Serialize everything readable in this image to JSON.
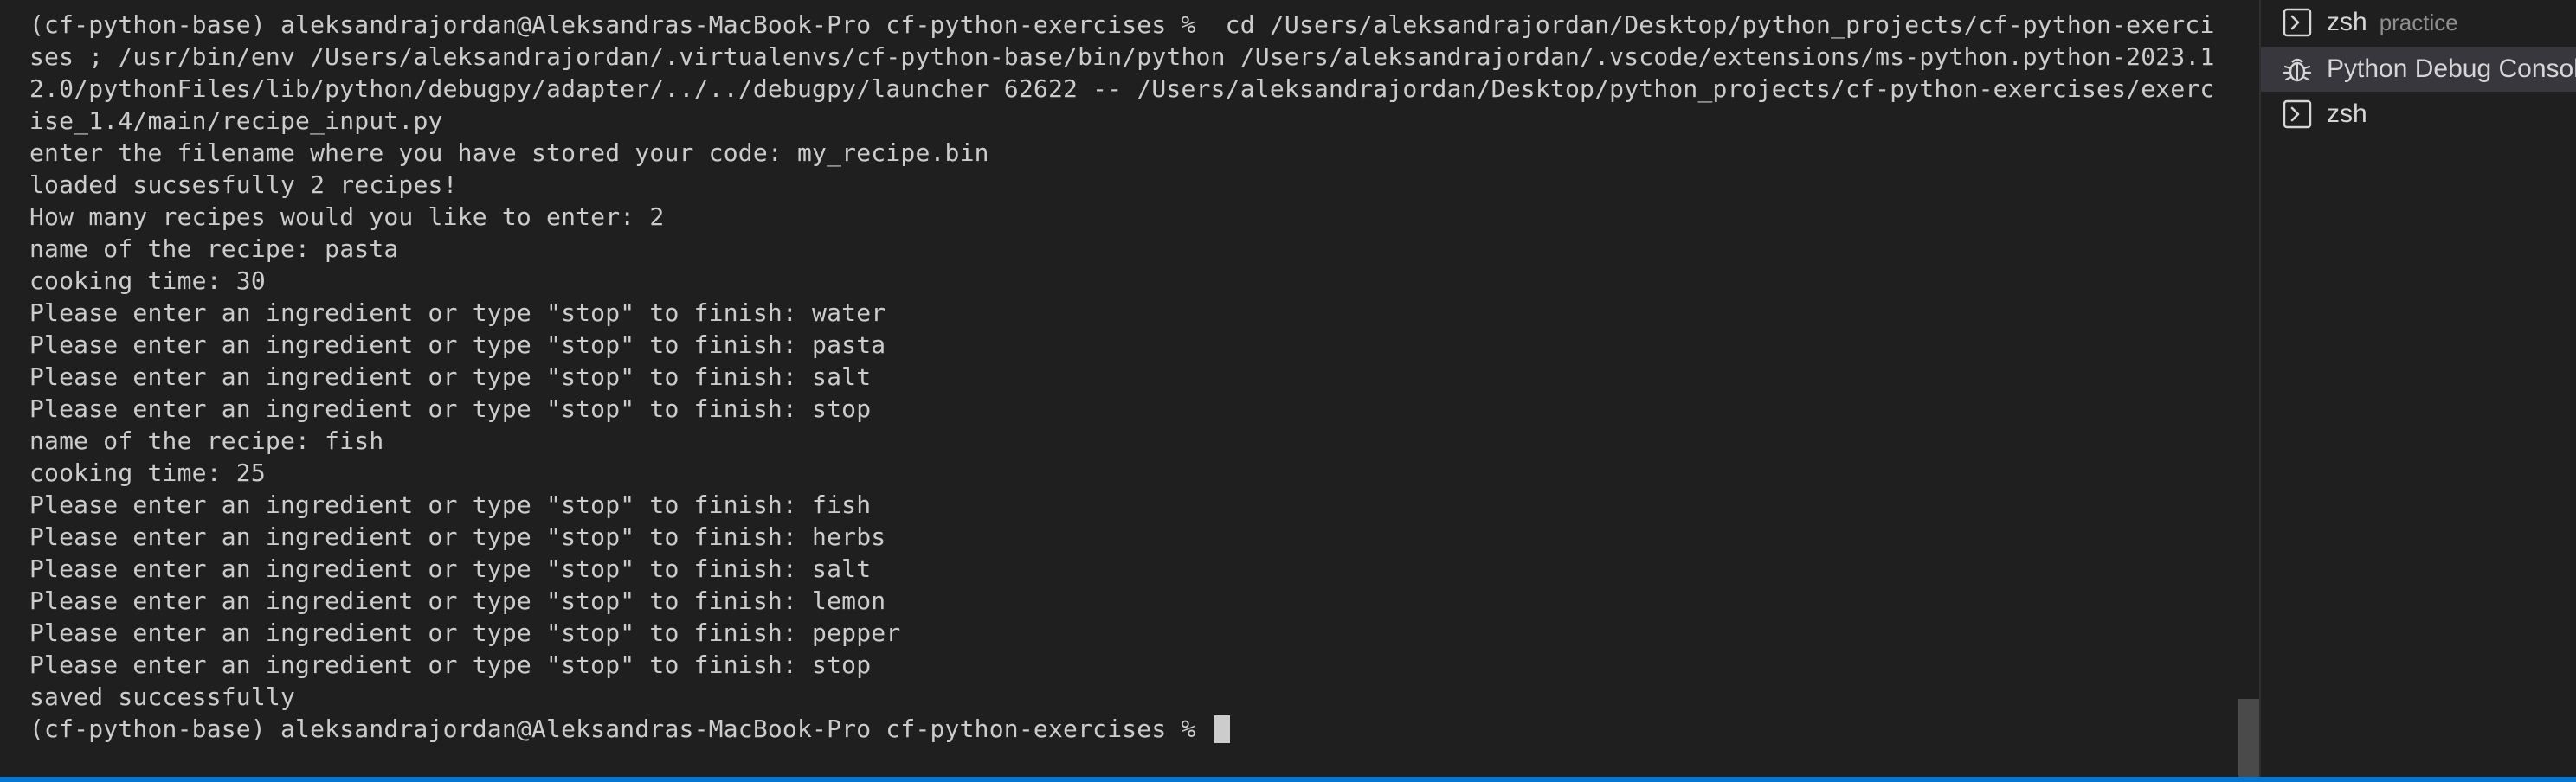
{
  "terminal": {
    "lines": [
      "(cf-python-base) aleksandrajordan@Aleksandras-MacBook-Pro cf-python-exercises %  cd /Users/aleksandrajordan/Desktop/python_projects/cf-python-exerci",
      "ses ; /usr/bin/env /Users/aleksandrajordan/.virtualenvs/cf-python-base/bin/python /Users/aleksandrajordan/.vscode/extensions/ms-python.python-2023.1",
      "2.0/pythonFiles/lib/python/debugpy/adapter/../../debugpy/launcher 62622 -- /Users/aleksandrajordan/Desktop/python_projects/cf-python-exercises/exerc",
      "ise_1.4/main/recipe_input.py",
      "enter the filename where you have stored your code: my_recipe.bin",
      "loaded sucsesfully 2 recipes!",
      "How many recipes would you like to enter: 2",
      "name of the recipe: pasta",
      "cooking time: 30",
      "Please enter an ingredient or type \"stop\" to finish: water",
      "Please enter an ingredient or type \"stop\" to finish: pasta",
      "Please enter an ingredient or type \"stop\" to finish: salt",
      "Please enter an ingredient or type \"stop\" to finish: stop",
      "name of the recipe: fish",
      "cooking time: 25",
      "Please enter an ingredient or type \"stop\" to finish: fish",
      "Please enter an ingredient or type \"stop\" to finish: herbs",
      "Please enter an ingredient or type \"stop\" to finish: salt",
      "Please enter an ingredient or type \"stop\" to finish: lemon",
      "Please enter an ingredient or type \"stop\" to finish: pepper",
      "Please enter an ingredient or type \"stop\" to finish: stop",
      "saved successfully"
    ],
    "prompt": "(cf-python-base) aleksandrajordan@Aleksandras-MacBook-Pro cf-python-exercises % "
  },
  "terminal_list": {
    "items": [
      {
        "icon": "terminal-icon",
        "label": "zsh",
        "sublabel": "practice",
        "active": false
      },
      {
        "icon": "debug-icon",
        "label": "Python Debug Console",
        "sublabel": "",
        "active": true
      },
      {
        "icon": "terminal-icon",
        "label": "zsh",
        "sublabel": "",
        "active": false
      }
    ]
  },
  "colors": {
    "background": "#1f1f1f",
    "text": "#cccccc",
    "active_item": "#37373d",
    "status_bar": "#0078d4"
  }
}
